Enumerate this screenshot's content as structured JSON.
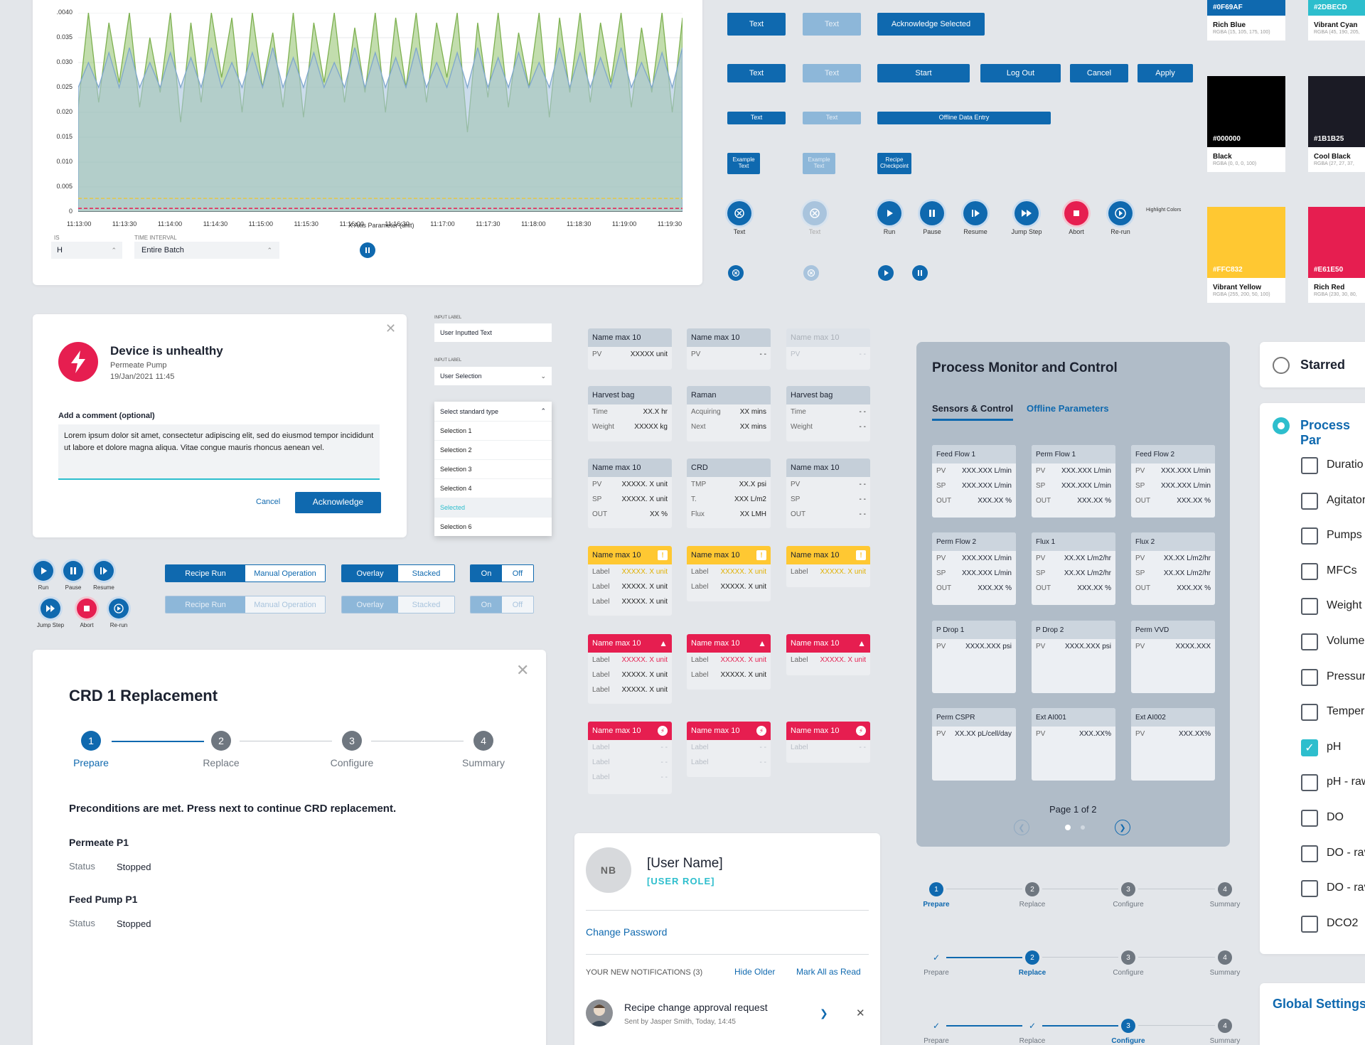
{
  "chart": {
    "yticks": [
      ".0040",
      "0.035",
      "0.030",
      "0.025",
      "0.020",
      "0.015",
      "0.010",
      "0.005",
      "0"
    ],
    "xticks": [
      "11:13:00",
      "11:13:30",
      "11:14:00",
      "11:14:30",
      "11:15:00",
      "11:15:30",
      "11:16:00",
      "11:16:30",
      "11:17:00",
      "11:17:30",
      "11:18:00",
      "11:18:30",
      "11:19:00",
      "11:19:30"
    ],
    "xlabel": "X Axis Parameter (unit)",
    "field1_label": "IS",
    "field1_value": "H",
    "field2_label": "TIME INTERVAL",
    "field2_value": "Entire Batch"
  },
  "chart_data": {
    "type": "area",
    "xlabel": "X Axis Parameter (unit)",
    "ylim": [
      0,
      0.04
    ],
    "x_range": [
      "11:13:00",
      "11:19:45"
    ],
    "series": [
      {
        "color": "#8fc16a",
        "values": [
          0.021,
          0.04,
          0.022,
          0.038,
          0.026,
          0.04,
          0.021,
          0.035,
          0.024,
          0.04,
          0.018,
          0.038,
          0.022,
          0.04,
          0.027,
          0.039,
          0.02,
          0.04,
          0.025,
          0.036,
          0.021,
          0.04,
          0.019,
          0.038,
          0.026,
          0.04,
          0.022,
          0.037,
          0.024,
          0.04,
          0.02,
          0.039,
          0.025,
          0.04,
          0.022,
          0.038,
          0.027,
          0.04,
          0.016,
          0.038,
          0.023,
          0.04,
          0.021,
          0.036,
          0.025,
          0.04,
          0.019,
          0.039,
          0.024,
          0.04,
          0.022,
          0.038,
          0.026,
          0.04,
          0.021,
          0.037,
          0.024,
          0.04,
          0.02,
          0.039
        ]
      },
      {
        "color": "#a9c4dd",
        "values": [
          0.025,
          0.03,
          0.025,
          0.032,
          0.025,
          0.033,
          0.025,
          0.03,
          0.025,
          0.032,
          0.025,
          0.031,
          0.025,
          0.033,
          0.025,
          0.03,
          0.025,
          0.032,
          0.025,
          0.033,
          0.025,
          0.031,
          0.025,
          0.032,
          0.025,
          0.03,
          0.025,
          0.033,
          0.025,
          0.032,
          0.025,
          0.031,
          0.025,
          0.033,
          0.025,
          0.03,
          0.025,
          0.032,
          0.025,
          0.033,
          0.025,
          0.031,
          0.025,
          0.032,
          0.025,
          0.03,
          0.025,
          0.033,
          0.025,
          0.032,
          0.025,
          0.031,
          0.025,
          0.033,
          0.025,
          0.03,
          0.025,
          0.032,
          0.025,
          0.033
        ]
      }
    ],
    "threshold_lines": [
      {
        "value": 0.0027,
        "color": "#e3c64a"
      },
      {
        "value": 0.0007,
        "color": "#e61e50"
      }
    ]
  },
  "buttons": {
    "text": "Text",
    "acknowledge_selected": "Acknowledge Selected",
    "start": "Start",
    "logout": "Log Out",
    "cancel": "Cancel",
    "apply": "Apply",
    "offline_data_entry": "Offline Data Entry",
    "example_text": "Example Text",
    "recipe_checkpoint": "Recipe Checkpoint",
    "highlight_colors": "Highlight Colors"
  },
  "icon_buttons": {
    "text": "Text",
    "run": "Run",
    "pause": "Pause",
    "resume": "Resume",
    "jump_step": "Jump Step",
    "abort": "Abort",
    "rerun": "Re-run"
  },
  "swatches": [
    {
      "hex": "#0F69AF",
      "name": "Rich Blue",
      "rgba": "RGBA (15, 105, 175, 100)",
      "color": "#0f69af"
    },
    {
      "hex": "#2DBECD",
      "name": "Vibrant Cyan",
      "rgba": "RGBA (45, 190, 205,",
      "color": "#2dbecd"
    },
    {
      "hex": "#000000",
      "name": "Black",
      "rgba": "RGBA (0, 0, 0, 100)",
      "color": "#000000"
    },
    {
      "hex": "#1B1B25",
      "name": "Cool Black",
      "rgba": "RGBA (27, 27, 37,",
      "color": "#1b1b25"
    },
    {
      "hex": "#FFC832",
      "name": "Vibrant Yellow",
      "rgba": "RGBA (255, 200, 50, 100)",
      "color": "#ffc832"
    },
    {
      "hex": "#E61E50",
      "name": "Rich Red",
      "rgba": "RGBA (230, 30, 80,",
      "color": "#e61e50"
    }
  ],
  "alert": {
    "title": "Device is unhealthy",
    "device": "Permeate Pump",
    "datetime": "19/Jan/2021  11:45",
    "comment_label": "Add a comment (optional)",
    "comment_value": "Lorem ipsum dolor sit amet, consectetur adipiscing elit, sed do eiusmod tempor incididunt ut labore et dolore magna aliqua. Vitae congue mauris rhoncus aenean vel.",
    "cancel": "Cancel",
    "acknowledge": "Acknowledge"
  },
  "inputs": {
    "label1": "INPUT LABEL",
    "value1": "User Inputted Text",
    "label2": "INPUT LABEL",
    "value2": "User Selection",
    "dropdown_title": "Select standard type",
    "options": [
      "Selection 1",
      "Selection 2",
      "Selection 3",
      "Selection 4",
      "Selected",
      "Selection 6"
    ]
  },
  "playback": {
    "run": "Run",
    "pause": "Pause",
    "resume": "Resume",
    "jump_step": "Jump Step",
    "abort": "Abort",
    "rerun": "Re-run"
  },
  "toggles": {
    "recipe_run": "Recipe Run",
    "manual_operation": "Manual Operation",
    "overlay": "Overlay",
    "stacked": "Stacked",
    "on": "On",
    "off": "Off"
  },
  "tiles": {
    "name": "Name max 10",
    "pv": "PV",
    "sp": "SP",
    "out": "OUT",
    "label": "Label",
    "pv_unit": "XXXXX unit",
    "dash": "- -",
    "harvest_bag": "Harvest bag",
    "raman": "Raman",
    "crd": "CRD",
    "time": "Time",
    "weight": "Weight",
    "acquiring": "Acquiring",
    "next": "Next",
    "time_val": "XX.X hr",
    "weight_val": "XXXXX kg",
    "mins": "XX mins",
    "tmp": "TMP",
    "t": "T.",
    "flux": "Flux",
    "tmp_val": "XX.X psi",
    "t_val": "XXX L/m2",
    "flux_val": "XX LMH",
    "unit_val": "XXXXX. X unit",
    "pct": "XX %"
  },
  "process": {
    "title": "Process Monitor and Control",
    "tab_active": "Sensors & Control",
    "tab_other": "Offline Parameters",
    "pv": "PV",
    "sp": "SP",
    "out": "OUT",
    "tiles": [
      {
        "name": "Feed Flow 1",
        "pv": "XXX.XXX L/min",
        "sp": "XXX.XXX L/min",
        "out": "XXX.XX %"
      },
      {
        "name": "Perm Flow 1",
        "pv": "XXX.XXX L/min",
        "sp": "XXX.XXX L/min",
        "out": "XXX.XX %"
      },
      {
        "name": "Feed Flow 2",
        "pv": "XXX.XXX L/min",
        "sp": "XXX.XXX L/min",
        "out": "XXX.XX %"
      },
      {
        "name": "Perm Flow 2",
        "pv": "XXX.XXX L/min",
        "sp": "XXX.XXX L/min",
        "out": "XXX.XX %"
      },
      {
        "name": "Flux 1",
        "pv": "XX.XX L/m2/hr",
        "sp": "XX.XX L/m2/hr",
        "out": "XXX.XX %"
      },
      {
        "name": "Flux 2",
        "pv": "XX.XX L/m2/hr",
        "sp": "XX.XX L/m2/hr",
        "out": "XXX.XX %"
      },
      {
        "name": "P Drop 1",
        "pv": "XXXX.XXX psi"
      },
      {
        "name": "P Drop 2",
        "pv": "XXXX.XXX psi"
      },
      {
        "name": "Perm VVD",
        "pv": "XXXX.XXX"
      },
      {
        "name": "Perm CSPR",
        "pv": "XX.XX pL/cell/day"
      },
      {
        "name": "Ext AI001",
        "pv": "XXX.XX%"
      },
      {
        "name": "Ext AI002",
        "pv": "XXX.XX%"
      }
    ],
    "page": "Page 1 of 2"
  },
  "sidebar": {
    "starred": "Starred",
    "process_param": "Process Par",
    "items": [
      "Duratio",
      "Agitator",
      "Pumps",
      "MFCs",
      "Weight",
      "Volume",
      "Pressur",
      "Tempera",
      "pH",
      "pH - raw",
      "DO",
      "DO - rav",
      "DO - rav",
      "DCO2"
    ],
    "global_settings": "Global Settings"
  },
  "wizard": {
    "title": "CRD 1 Replacement",
    "steps": [
      "Prepare",
      "Replace",
      "Configure",
      "Summary"
    ],
    "message": "Preconditions are met. Press next to continue CRD replacement.",
    "section1": "Permeate P1",
    "section2": "Feed Pump P1",
    "status_label": "Status",
    "status_value": "Stopped"
  },
  "user": {
    "initials": "NB",
    "name": "[User Name]",
    "role": "[USER ROLE]",
    "change_password": "Change Password",
    "notifications_header": "YOUR NEW NOTIFICATIONS (3)",
    "hide_older": "Hide Older",
    "mark_all": "Mark All as Read",
    "notif_title": "Recipe change approval request",
    "notif_sub": "Sent by Jasper Smith, Today, 14:45"
  },
  "steppers": {
    "labels": [
      "Prepare",
      "Replace",
      "Configure",
      "Summary"
    ]
  }
}
